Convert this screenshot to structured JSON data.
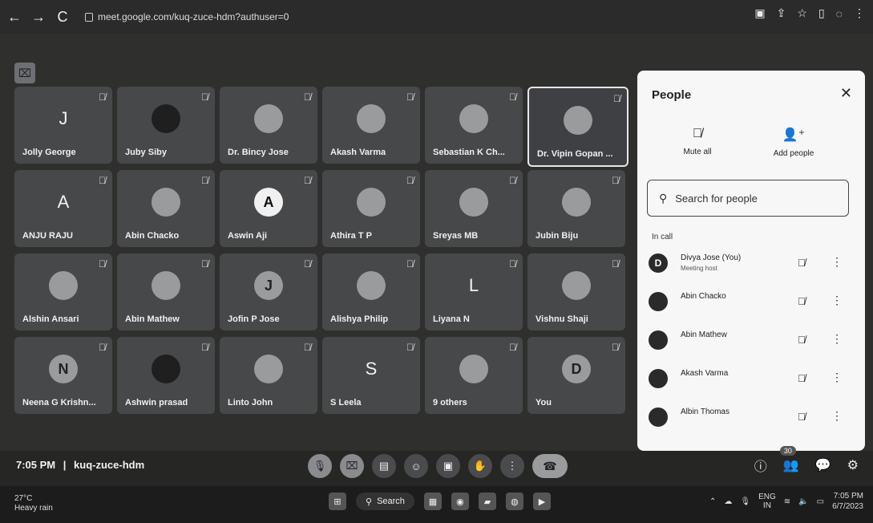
{
  "browser": {
    "url": "meet.google.com/kuq-zuce-hdm?authuser=0",
    "back": "←",
    "forward": "→",
    "reload": "C"
  },
  "tiles": [
    {
      "name": "Jolly George",
      "avatar": "J",
      "style": "letter"
    },
    {
      "name": "Juby Siby",
      "avatar": "",
      "style": "dark"
    },
    {
      "name": "Dr. Bincy Jose",
      "avatar": "",
      "style": "photo"
    },
    {
      "name": "Akash Varma",
      "avatar": "",
      "style": "photo"
    },
    {
      "name": "Sebastian K Ch...",
      "avatar": "",
      "style": "photo"
    },
    {
      "name": "Dr. Vipin Gopan ...",
      "avatar": "",
      "style": "photo",
      "active": true
    },
    {
      "name": "ANJU RAJU",
      "avatar": "A",
      "style": "letter"
    },
    {
      "name": "Abin Chacko",
      "avatar": "",
      "style": "photo"
    },
    {
      "name": "Aswin Aji",
      "avatar": "A",
      "style": "white"
    },
    {
      "name": "Athira T P",
      "avatar": "",
      "style": "photo"
    },
    {
      "name": "Sreyas MB",
      "avatar": "",
      "style": "photo"
    },
    {
      "name": "Jubin Biju",
      "avatar": "",
      "style": "photo"
    },
    {
      "name": "Alshin Ansari",
      "avatar": "",
      "style": "photo"
    },
    {
      "name": "Abin Mathew",
      "avatar": "",
      "style": "photo"
    },
    {
      "name": "Jofin P Jose",
      "avatar": "J",
      "style": "photo"
    },
    {
      "name": "Alishya Philip",
      "avatar": "",
      "style": "photo"
    },
    {
      "name": "Liyana N",
      "avatar": "L",
      "style": "letter"
    },
    {
      "name": "Vishnu Shaji",
      "avatar": "",
      "style": "photo"
    },
    {
      "name": "Neena G Krishn...",
      "avatar": "N",
      "style": "photo"
    },
    {
      "name": "Ashwin prasad",
      "avatar": "",
      "style": "dark"
    },
    {
      "name": "Linto John",
      "avatar": "",
      "style": "photo"
    },
    {
      "name": "S Leela",
      "avatar": "S",
      "style": "letter"
    },
    {
      "name": "9 others",
      "avatar": "",
      "style": "photo"
    },
    {
      "name": "You",
      "avatar": "D",
      "style": "photo"
    }
  ],
  "panel": {
    "title": "People",
    "mute_all": "Mute all",
    "add_people": "Add people",
    "search_placeholder": "Search for people",
    "in_call": "In call",
    "people": [
      {
        "name": "Divya Jose (You)",
        "sub": "Meeting host",
        "avatar": "D"
      },
      {
        "name": "Abin Chacko",
        "sub": "",
        "avatar": ""
      },
      {
        "name": "Abin Mathew",
        "sub": "",
        "avatar": ""
      },
      {
        "name": "Akash Varma",
        "sub": "",
        "avatar": ""
      },
      {
        "name": "Albin Thomas",
        "sub": "",
        "avatar": ""
      }
    ]
  },
  "bottom": {
    "time": "7:05 PM",
    "separator": "|",
    "code": "kuq-zuce-hdm",
    "people_count": "30"
  },
  "taskbar": {
    "temp": "27°C",
    "weather": "Heavy rain",
    "search": "Search",
    "lang1": "ENG",
    "lang2": "IN",
    "time": "7:05 PM",
    "date": "6/7/2023"
  }
}
